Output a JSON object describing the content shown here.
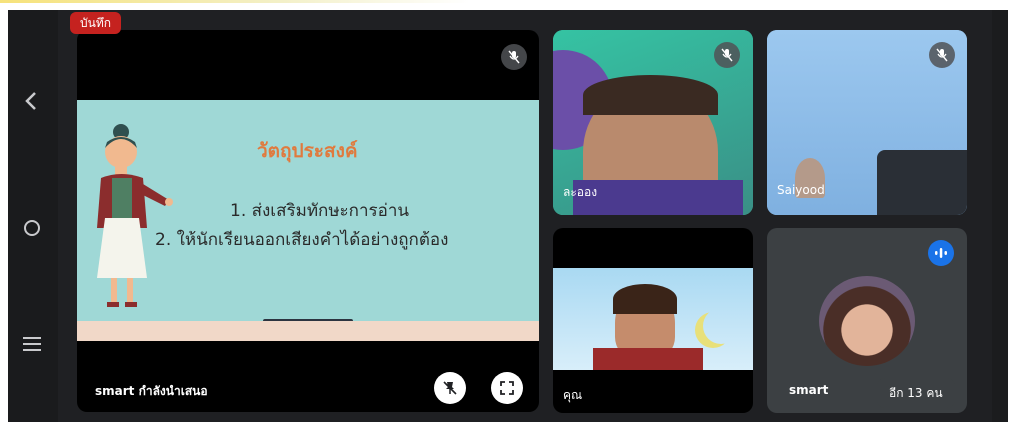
{
  "recording_badge": "บันทึก",
  "nav": {
    "back_icon": "chevron-left-icon",
    "home_icon": "circle-home-icon",
    "menu_icon": "hamburger-menu-icon"
  },
  "presentation": {
    "presenter_label": "smart กำลังนำเสนอ",
    "slide": {
      "title": "วัตถุประสงค์",
      "line1": "1. ส่งเสริมทักษะการอ่าน",
      "line2": "2. ให้นักเรียนออกเสียงคำได้อย่างถูกต้อง"
    },
    "mic_icon": "mic-off-icon",
    "unpin_icon": "unpin-icon",
    "fullscreen_icon": "fullscreen-icon"
  },
  "participants": [
    {
      "name": "ละออง",
      "mic": "mic-off-icon"
    },
    {
      "name": "Saiyood",
      "mic": "mic-off-icon"
    },
    {
      "name": "คุณ"
    },
    {
      "name": "smart",
      "audio_icon": "audio-level-icon"
    }
  ],
  "more_participants": "อีก 13 คน",
  "colors": {
    "accent_blue": "#1a73e8",
    "record_red": "#c5221f",
    "slide_bg": "#9fd8d6",
    "title_orange": "#e07a3e"
  }
}
